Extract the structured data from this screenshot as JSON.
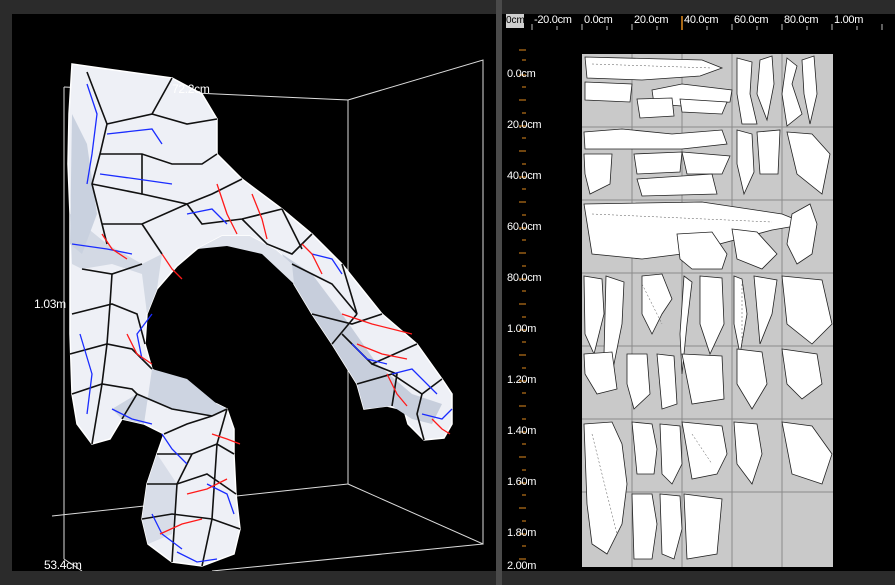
{
  "viewport3d": {
    "dimension_width": "72.2cm",
    "dimension_height": "1.03m",
    "dimension_depth": "53.4cm"
  },
  "layout2d": {
    "corner_label": "0cm",
    "ruler_top": [
      "-20.0cm",
      "0.0cm",
      "20.0cm",
      "40.0cm",
      "60.0cm",
      "80.0cm",
      "1.00m"
    ],
    "ruler_left": [
      "0.0cm",
      "20.0cm",
      "40.0cm",
      "60.0cm",
      "80.0cm",
      "1.00m",
      "1.20m",
      "1.40m",
      "1.60m",
      "1.80m",
      "2.00m"
    ]
  },
  "colors": {
    "viewport_bg": "#000000",
    "mesh_fill": "#f2f4fa",
    "mesh_shade": "#c8d0de",
    "seam_blue": "#1a2cff",
    "seam_red": "#ff1a1a",
    "sheet_bg": "#c9c9c9",
    "ruler_tick_orange": "#e08a1e"
  }
}
